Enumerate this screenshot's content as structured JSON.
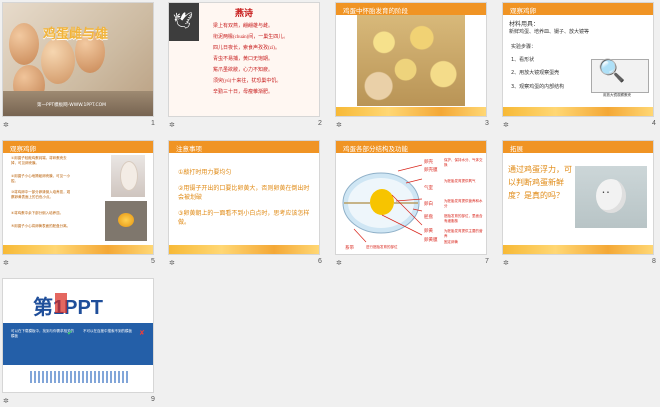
{
  "slides": [
    {
      "number": "1",
      "title": "鸡蛋雌与雄",
      "subtitle": "第一PPT模板网-WWW.1PPT.COM"
    },
    {
      "number": "2",
      "title": "燕诗",
      "poem": "梁上有双燕，翩翩雄与雌。\n衔泥两椽(chuán)间，一巢生四儿。\n四儿日夜长，索食声孜孜(zī)。\n青虫不易捕，黄口无饱期。\n觜爪虽欲敝，心力不知疲。\n须臾(yú)十来往，犹恐巢中饥。\n辛勤三十日，母瘦雏渐肥。"
    },
    {
      "number": "3",
      "title": "鸡蛋中怀胎发育的阶段"
    },
    {
      "number": "4",
      "title": "观察鸡卵",
      "materials_label": "材料用具：",
      "materials": "新鲜鸡蛋、培养皿、镊子、放大镜等",
      "steps_label": "实验步骤：",
      "steps": [
        "1、看形状",
        "2、用放大镜观察蛋壳",
        "3、观察鸡蛋的内部结构"
      ],
      "caption": "用放大镜观察蛋壳"
    },
    {
      "number": "5",
      "title": "观察鸡卵",
      "notes": [
        "①用镊子轻敲鸡蛋钝端，将碎蛋壳去掉，可见卵壳膜。",
        "②用镊子小心地撕破卵壳膜，可见一小腔。",
        "③将鸡卵中一部分卵清倒入培养皿，观察卵黄表面上的白色小点。",
        "④将鸡蛋中余下部分倒入培养皿。",
        "⑤用镊子小心将卵黄表面的胚盘分离。"
      ]
    },
    {
      "number": "6",
      "title": "注意事项",
      "items": [
        "①敲打时用力要均匀",
        "②用镊子开出的口要比卵黄大，否则卵黄在倒出时会被划破",
        "③卵黄朝上的一面看不到小白点时，思考应该怎样做。"
      ]
    },
    {
      "number": "7",
      "title": "鸡蛋各部分结构及功能",
      "labels": [
        "卵壳",
        "卵壳膜",
        "卵白",
        "气室",
        "胚盘",
        "卵黄",
        "卵黄膜",
        "系带"
      ],
      "functions": [
        "保护、保持水分、气体交换",
        "为胚胎发育提供氧气",
        "为胚胎发育提供营养和水分",
        "胚胎发育的部位，里面含有细胞核",
        "为胚胎发育提供主要的营养",
        "固定卵黄",
        "进行胚胎发育的部位"
      ]
    },
    {
      "number": "8",
      "title": "拓展",
      "question": "通过鸡蛋浮力，可以判断鸡蛋新鲜度？是真的吗？"
    },
    {
      "number": "9",
      "logo": "第1PPT",
      "slogan_left": "可以在下载模板中，找到与你需求相关的模板",
      "slogan_right": "不可以在百度中搜索不到的模板"
    }
  ],
  "colors": {
    "orange": "#f09424",
    "bar_text": "#ffffff",
    "red": "#d9261c",
    "blue": "#1f4e9a"
  }
}
